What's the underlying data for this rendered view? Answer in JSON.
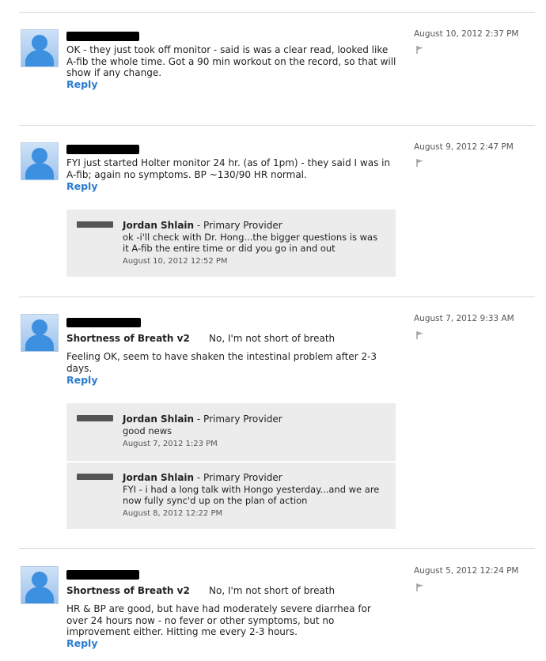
{
  "entries": [
    {
      "text": "OK - they just took off monitor - said is was a clear read, looked like A-fib the whole time. Got a 90 min workout on the record, so that will show if any change.",
      "reply_label": "Reply",
      "date": "August 10, 2012 2:37 PM"
    },
    {
      "text": "FYI just started Holter monitor 24 hr. (as of 1pm) - they said I was in A-fib; again no symptoms. BP ~130/90 HR normal.",
      "reply_label": "Reply",
      "date": "August 9, 2012 2:47 PM",
      "replies": [
        {
          "author": "Jordan Shlain",
          "role": " - Primary Provider",
          "text": "ok -i'll check with Dr. Hong...the bigger questions is was it A-fib the entire time or did you go in and out",
          "date": "August 10, 2012 12:52 PM"
        }
      ]
    },
    {
      "survey_title": "Shortness of Breath v2",
      "survey_answer": "No, I'm not short of breath",
      "text": "Feeling OK, seem to have shaken the intestinal problem after 2-3 days.",
      "reply_label": "Reply",
      "date": "August 7, 2012 9:33 AM",
      "replies": [
        {
          "author": "Jordan Shlain",
          "role": " - Primary Provider",
          "text": "good news",
          "date": "August 7, 2012 1:23 PM"
        },
        {
          "author": "Jordan Shlain",
          "role": " - Primary Provider",
          "text": "FYI - i had a long talk with Hongo yesterday...and we are now fully sync'd up on the plan of action",
          "date": "August 8, 2012 12:22 PM"
        }
      ]
    },
    {
      "survey_title": "Shortness of Breath v2",
      "survey_answer": "No, I'm not short of breath",
      "text": "HR & BP are good, but have had moderately severe diarrhea for over 24 hours now - no fever or other symptoms, but no improvement either. Hitting me every 2-3 hours.",
      "reply_label": "Reply",
      "date": "August 5, 2012 12:24 PM"
    }
  ]
}
